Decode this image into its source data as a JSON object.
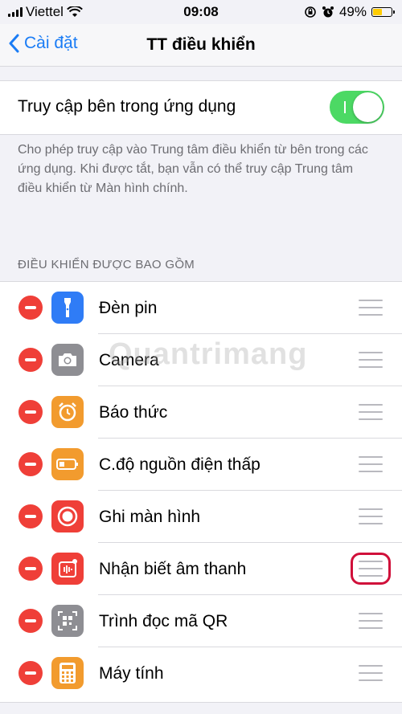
{
  "status": {
    "carrier": "Viettel",
    "time": "09:08",
    "battery": "49%"
  },
  "nav": {
    "back_label": "Cài đặt",
    "title": "TT điều khiển"
  },
  "access": {
    "label": "Truy cập bên trong ứng dụng",
    "enabled": true,
    "footnote": "Cho phép truy cập vào Trung tâm điều khiển từ bên trong các ứng dụng. Khi được tắt, bạn vẫn có thể truy cập Trung tâm điều khiển từ Màn hình chính."
  },
  "included": {
    "header": "ĐIỀU KHIỂN ĐƯỢC BAO GỒM",
    "items": [
      {
        "label": "Đèn pin",
        "icon": "flashlight-icon",
        "color": "#2f7cf6"
      },
      {
        "label": "Camera",
        "icon": "camera-icon",
        "color": "#8e8e93"
      },
      {
        "label": "Báo thức",
        "icon": "alarm-icon",
        "color": "#f29b2e"
      },
      {
        "label": "C.độ nguồn điện thấp",
        "icon": "low-power-icon",
        "color": "#f29b2e"
      },
      {
        "label": "Ghi màn hình",
        "icon": "screen-record-icon",
        "color": "#ef3f38"
      },
      {
        "label": "Nhận biết âm thanh",
        "icon": "sound-recognition-icon",
        "color": "#ef3f38"
      },
      {
        "label": "Trình đọc mã QR",
        "icon": "qr-code-icon",
        "color": "#8e8e93"
      },
      {
        "label": "Máy tính",
        "icon": "calculator-icon",
        "color": "#f29b2e"
      }
    ]
  },
  "watermark": "Quantrimang"
}
